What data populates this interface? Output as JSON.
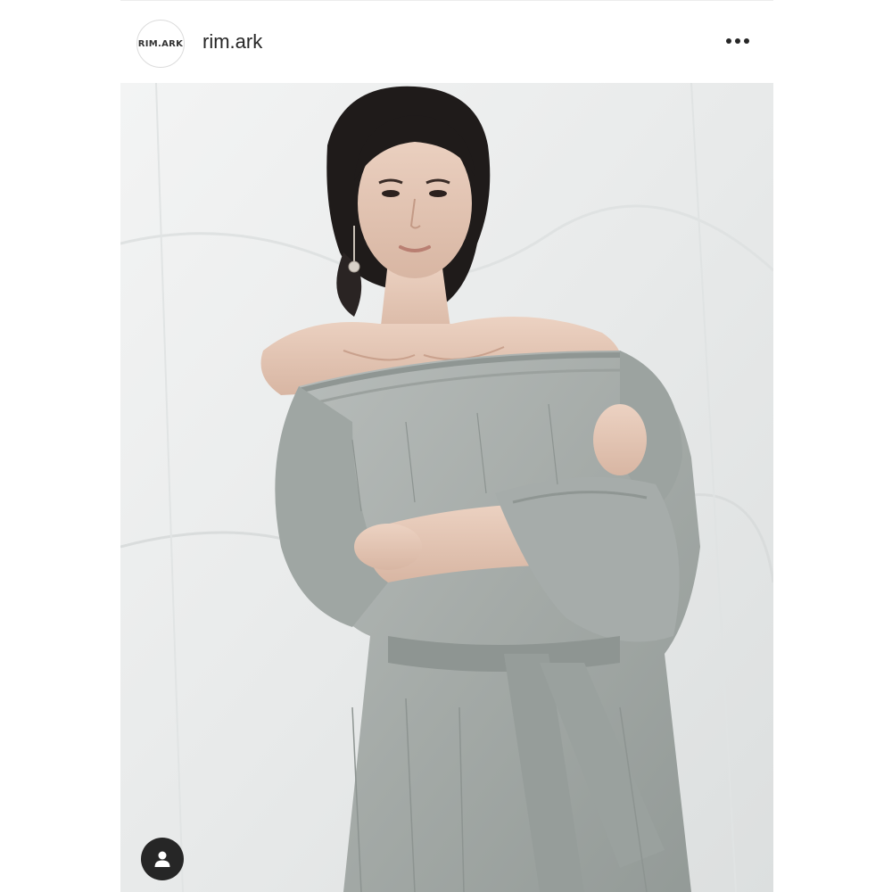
{
  "post": {
    "account": {
      "avatar_text": "RIM.ARK",
      "username": "rim.ark"
    },
    "icons": {
      "more": "more-options-icon",
      "user_tag": "person-icon"
    },
    "colors": {
      "username": "#262626",
      "tag_button": "#262626",
      "photo_background": "#eceded",
      "dress": "#a7adaa"
    }
  }
}
